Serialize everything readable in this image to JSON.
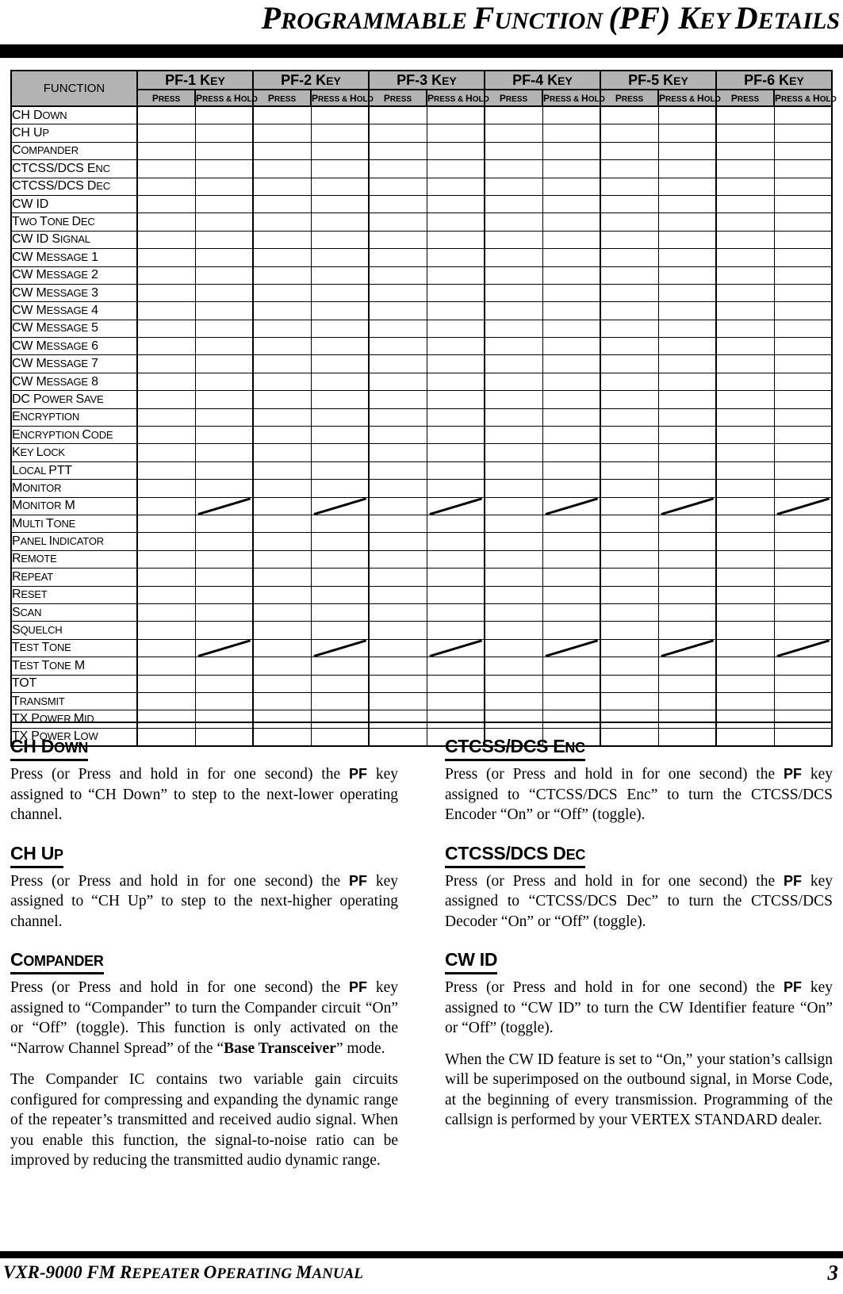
{
  "page": {
    "title_main": "PROGRAMMABLE FUNCTION (PF) KEY DETAILS",
    "title_parts": [
      {
        "big": "P",
        "small": "ROGRAMMABLE "
      },
      {
        "big": "F",
        "small": "UNCTION "
      },
      {
        "big": "(PF) ",
        "small": ""
      },
      {
        "big": "K",
        "small": "EY "
      },
      {
        "big": "D",
        "small": "ETAILS"
      }
    ]
  },
  "table": {
    "function_header": "FUNCTION",
    "function_header_parts": {
      "big": "F",
      "small": "UNCTION"
    },
    "key_groups": [
      {
        "label": "PF-1",
        "key_word": "KEY",
        "key_small": "EY"
      },
      {
        "label": "PF-2",
        "key_word": "KEY",
        "key_small": "EY"
      },
      {
        "label": "PF-3",
        "key_word": "KEY",
        "key_small": "EY"
      },
      {
        "label": "PF-4",
        "key_word": "KEY",
        "key_small": "EY"
      },
      {
        "label": "PF-5",
        "key_word": "KEY",
        "key_small": "EY"
      },
      {
        "label": "PF-6",
        "key_word": "KEY",
        "key_small": "EY"
      }
    ],
    "sub_headers": [
      "PRESS",
      "PRESS & HOLD"
    ],
    "sub_header_parts": [
      {
        "big": "P",
        "small": "RESS"
      },
      {
        "big": "P",
        "small": "RESS & ",
        "big2": "H",
        "small2": "OLD"
      }
    ],
    "rows": [
      {
        "label": "CH DOWN",
        "big": "CH D",
        "small": "OWN",
        "marks": []
      },
      {
        "label": "CH UP",
        "big": "CH U",
        "small": "P",
        "marks": []
      },
      {
        "label": "COMPANDER",
        "big": "C",
        "small": "OMPANDER",
        "marks": []
      },
      {
        "label": "CTCSS/DCS ENC",
        "big": "CTCSS/DCS E",
        "small": "NC",
        "marks": []
      },
      {
        "label": "CTCSS/DCS DEC",
        "big": "CTCSS/DCS D",
        "small": "EC",
        "marks": []
      },
      {
        "label": "CW ID",
        "big": "CW ID",
        "small": "",
        "marks": []
      },
      {
        "label": "TWO TONE DEC",
        "big": "T",
        "small": "WO ",
        "big2": "T",
        "small2": "ONE ",
        "big3": "D",
        "small3": "EC",
        "marks": []
      },
      {
        "label": "CW ID SIGNAL",
        "big": "CW ID S",
        "small": "IGNAL",
        "marks": []
      },
      {
        "label": "CW MESSAGE 1",
        "big": "CW M",
        "small": "ESSAGE",
        "big2": " 1",
        "marks": []
      },
      {
        "label": "CW MESSAGE 2",
        "big": "CW M",
        "small": "ESSAGE",
        "big2": " 2",
        "marks": []
      },
      {
        "label": "CW MESSAGE 3",
        "big": "CW M",
        "small": "ESSAGE",
        "big2": " 3",
        "marks": []
      },
      {
        "label": "CW MESSAGE 4",
        "big": "CW M",
        "small": "ESSAGE",
        "big2": " 4",
        "marks": []
      },
      {
        "label": "CW MESSAGE 5",
        "big": "CW M",
        "small": "ESSAGE",
        "big2": " 5",
        "marks": []
      },
      {
        "label": "CW MESSAGE 6",
        "big": "CW M",
        "small": "ESSAGE",
        "big2": " 6",
        "marks": []
      },
      {
        "label": "CW MESSAGE 7",
        "big": "CW M",
        "small": "ESSAGE",
        "big2": " 7",
        "marks": []
      },
      {
        "label": "CW MESSAGE 8",
        "big": "CW M",
        "small": "ESSAGE",
        "big2": " 8",
        "marks": []
      },
      {
        "label": "DC POWER SAVE",
        "big": "DC P",
        "small": "OWER ",
        "big2": "S",
        "small2": "AVE",
        "marks": []
      },
      {
        "label": "ENCRYPTION",
        "big": "E",
        "small": "NCRYPTION",
        "marks": []
      },
      {
        "label": "ENCRYPTION CODE",
        "big": "E",
        "small": "NCRYPTION ",
        "big2": "C",
        "small2": "ODE",
        "marks": []
      },
      {
        "label": "KEY LOCK",
        "big": "K",
        "small": "EY ",
        "big2": "L",
        "small2": "OCK",
        "marks": []
      },
      {
        "label": "LOCAL PTT",
        "big": "L",
        "small": "OCAL ",
        "big2": "PTT",
        "marks": []
      },
      {
        "label": "MONITOR",
        "big": "M",
        "small": "ONITOR",
        "marks": []
      },
      {
        "label": "MONITOR M",
        "big": "M",
        "small": "ONITOR",
        "big2": " M",
        "marks": [
          1,
          3,
          5,
          7,
          9,
          11
        ]
      },
      {
        "label": "MULTI TONE",
        "big": "M",
        "small": "ULTI ",
        "big2": "T",
        "small2": "ONE",
        "marks": []
      },
      {
        "label": "PANEL INDICATOR",
        "big": "P",
        "small": "ANEL ",
        "big2": "I",
        "small2": "NDICATOR",
        "marks": []
      },
      {
        "label": "REMOTE",
        "big": "R",
        "small": "EMOTE",
        "marks": []
      },
      {
        "label": "REPEAT",
        "big": "R",
        "small": "EPEAT",
        "marks": []
      },
      {
        "label": "RESET",
        "big": "R",
        "small": "ESET",
        "marks": []
      },
      {
        "label": "SCAN",
        "big": "S",
        "small": "CAN",
        "marks": []
      },
      {
        "label": "SQUELCH",
        "big": "S",
        "small": "QUELCH",
        "marks": []
      },
      {
        "label": "TEST TONE",
        "big": "T",
        "small": "EST ",
        "big2": "T",
        "small2": "ONE",
        "marks": [
          1,
          3,
          5,
          7,
          9,
          11
        ]
      },
      {
        "label": "TEST TONE M",
        "big": "T",
        "small": "EST ",
        "big2": "T",
        "small2": "ONE",
        "big3": " M",
        "marks": []
      },
      {
        "label": "TOT",
        "big": "TOT",
        "small": "",
        "marks": []
      },
      {
        "label": "TRANSMIT",
        "big": "T",
        "small": "RANSMIT",
        "marks": []
      },
      {
        "label": "TX POWER MID",
        "big": "TX P",
        "small": "OWER ",
        "big2": "M",
        "small2": "ID",
        "marks": []
      },
      {
        "label": "TX POWER LOW",
        "big": "TX P",
        "small": "OWER ",
        "big2": "L",
        "small2": "OW",
        "marks": []
      }
    ]
  },
  "sections_left": [
    {
      "heading": "CH DOWN",
      "heading_big": "CH D",
      "heading_small": "OWN",
      "paragraphs": [
        "Press (or Press and hold in for one second) the PF key assigned to “CH Down” to step to the next-lower operating channel."
      ]
    },
    {
      "heading": "CH UP",
      "heading_big": "CH U",
      "heading_small": "P",
      "paragraphs": [
        "Press (or Press and hold in for one second) the PF key assigned to “CH Up” to step to the next-higher operating channel."
      ]
    },
    {
      "heading": "COMPANDER",
      "heading_big": "C",
      "heading_small": "OMPANDER",
      "paragraphs": [
        "Press (or Press and hold in for one second) the PF key assigned to “Compander” to turn the Compander circuit “On” or “Off” (toggle). This function is only activated on the “Narrow Channel Spread” of the “Base Transceiver” mode.",
        "The Compander IC contains two variable gain circuits configured for compressing and expanding the dynamic range of the repeater’s transmitted and received audio signal. When you enable this function, the signal-to-noise ratio can be improved by reducing the transmitted audio dynamic range."
      ]
    }
  ],
  "sections_right": [
    {
      "heading": "CTCSS/DCS ENC",
      "heading_big": "CTCSS/DCS E",
      "heading_small": "NC",
      "paragraphs": [
        "Press (or Press and hold in for one second) the PF key assigned to “CTCSS/DCS Enc” to turn the CTCSS/DCS Encoder “On” or “Off” (toggle)."
      ]
    },
    {
      "heading": "CTCSS/DCS DEC",
      "heading_big": "CTCSS/DCS D",
      "heading_small": "EC",
      "paragraphs": [
        "Press (or Press and hold in for one second) the PF key assigned to “CTCSS/DCS Dec” to turn the CTCSS/DCS Decoder “On” or “Off” (toggle)."
      ]
    },
    {
      "heading": "CW ID",
      "heading_big": "CW ID",
      "heading_small": "",
      "paragraphs": [
        "Press (or Press and hold in for one second) the PF key assigned to “CW ID” to turn the CW Identifier feature “On” or “Off” (toggle).",
        "When the CW ID feature is set to “On,” your station’s callsign will be superimposed on the outbound signal, in Morse Code, at the beginning of every transmission. Programming of the callsign is performed by your VERTEX STANDARD dealer."
      ]
    }
  ],
  "footer": {
    "title": "VXR-9000 FM REPEATER OPERATING MANUAL",
    "title_parts": [
      {
        "big": "VXR-9000 FM R",
        "small": "EPEATER "
      },
      {
        "big": "O",
        "small": "PERATING "
      },
      {
        "big": "M",
        "small": "ANUAL"
      }
    ],
    "page_number": "3"
  },
  "colors": {
    "header_fill": "#b3b3b3",
    "rule": "#000000",
    "text": "#000000",
    "background": "#ffffff"
  }
}
